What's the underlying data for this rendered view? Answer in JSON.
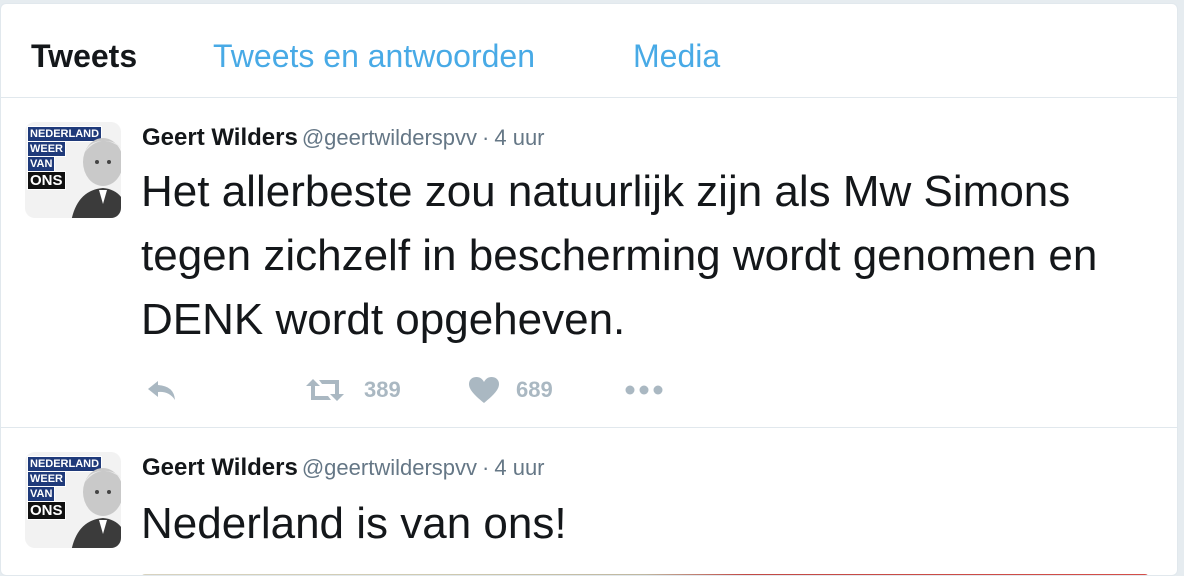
{
  "tabs": [
    {
      "label": "Tweets",
      "active": true
    },
    {
      "label": "Tweets en antwoorden",
      "active": false
    },
    {
      "label": "Media",
      "active": false
    }
  ],
  "colors": {
    "link": "#48aae6",
    "text": "#14171a",
    "muted": "#657786",
    "action": "#aab8c2"
  },
  "tweets": [
    {
      "avatar_text": [
        "NEDERLAND",
        "WEER",
        "VAN",
        "ONS"
      ],
      "name": "Geert Wilders",
      "handle": "@geertwilderspvv",
      "separator": "·",
      "time": "4 uur",
      "text": "Het allerbeste zou natuurlijk zijn als Mw Simons tegen zichzelf in bescherming wordt genomen en DENK wordt opgeheven.",
      "actions": {
        "retweets": "389",
        "likes": "689"
      },
      "icons": [
        "reply-icon",
        "retweet-icon",
        "heart-icon",
        "more-icon"
      ]
    },
    {
      "avatar_text": [
        "NEDERLAND",
        "WEER",
        "VAN",
        "ONS"
      ],
      "name": "Geert Wilders",
      "handle": "@geertwilderspvv",
      "separator": "·",
      "time": "4 uur",
      "text": "Nederland is van ons!"
    }
  ]
}
